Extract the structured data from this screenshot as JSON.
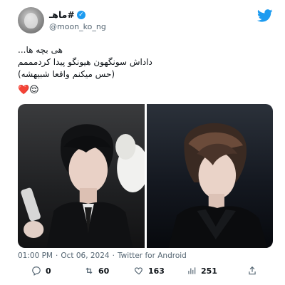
{
  "author": {
    "display_name": "ماهـ#",
    "handle": "@moon_ko_ng"
  },
  "tweet": {
    "lines": [
      "هی بچه ها...",
      "داداش سونگهون هیونگو پیدا کردمممم",
      "(حس میکنم واقعا شبیهشه)"
    ],
    "emojis": "❤️😌"
  },
  "meta": {
    "time": "01:00 PM",
    "date": "Oct 06, 2024",
    "source": "Twitter for Android"
  },
  "actions": {
    "replies": "0",
    "retweets": "60",
    "likes": "163",
    "views": "251"
  },
  "colors": {
    "brand": "#1d9bf0",
    "muted": "#536471",
    "heart": "#e0245e"
  }
}
